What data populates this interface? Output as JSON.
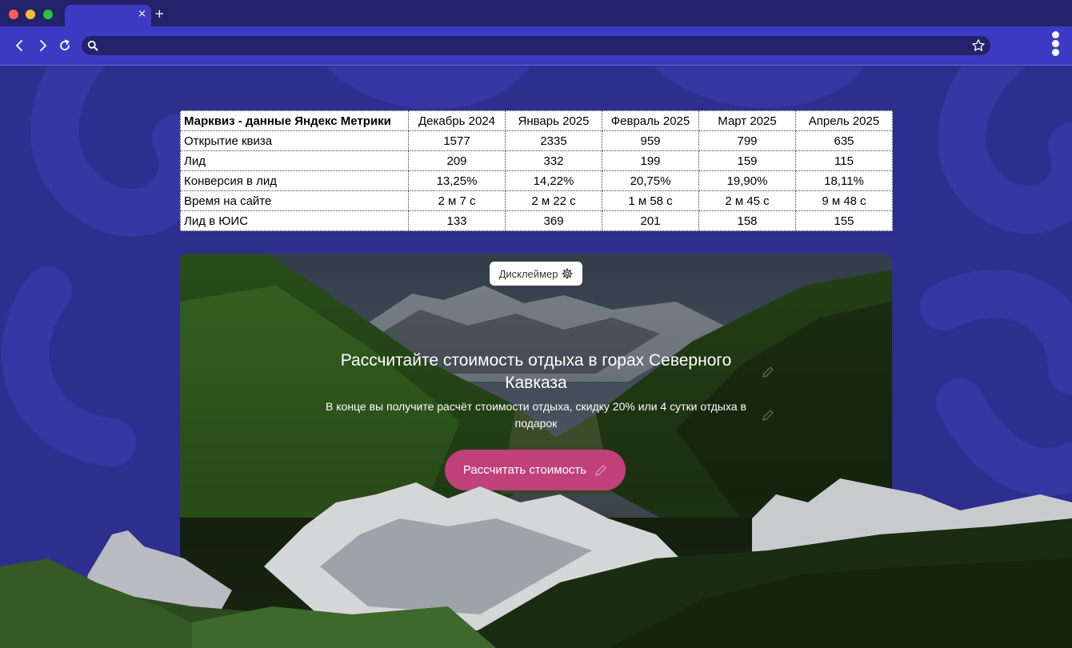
{
  "browser": {
    "tab_close": "×",
    "new_tab": "+",
    "address_value": ""
  },
  "table": {
    "headers": [
      "Марквиз - данные Яндекс Метрики",
      "Декабрь 2024",
      "Январь 2025",
      "Февраль 2025",
      "Март 2025",
      "Апрель 2025"
    ],
    "rows": [
      [
        "Открытие квиза",
        "1577",
        "2335",
        "959",
        "799",
        "635"
      ],
      [
        "Лид",
        "209",
        "332",
        "199",
        "159",
        "115"
      ],
      [
        "Конверсия в лид",
        "13,25%",
        "14,22%",
        "20,75%",
        "19,90%",
        "18,11%"
      ],
      [
        "Время на сайте",
        "2 м 7 с",
        "2 м 22 с",
        "1 м 58 с",
        "2 м 45 с",
        "9 м 48 с"
      ],
      [
        "Лид в ЮИС",
        "133",
        "369",
        "201",
        "158",
        "155"
      ]
    ]
  },
  "hero": {
    "disclaimer_label": "Дисклеймер",
    "title": "Рассчитайте стоимость отдыха в горах Северного Кавказа",
    "subtitle": "В конце вы получите расчёт стоимости отдыха, скидку 20% или 4 сутки отдыха в подарок",
    "cta_label": "Рассчитать стоимость"
  },
  "colors": {
    "chrome_dark": "#23226a",
    "chrome_accent": "#3b3bc4",
    "page_bg": "#2e2e8e",
    "cta": "#c0407a"
  },
  "icons": {
    "back": "chevron-left-icon",
    "forward": "chevron-right-icon",
    "reload": "reload-icon",
    "search": "search-icon",
    "bookmark": "star-icon",
    "menu": "kebab-menu-icon",
    "settings": "gear-icon",
    "edit": "pencil-icon"
  }
}
